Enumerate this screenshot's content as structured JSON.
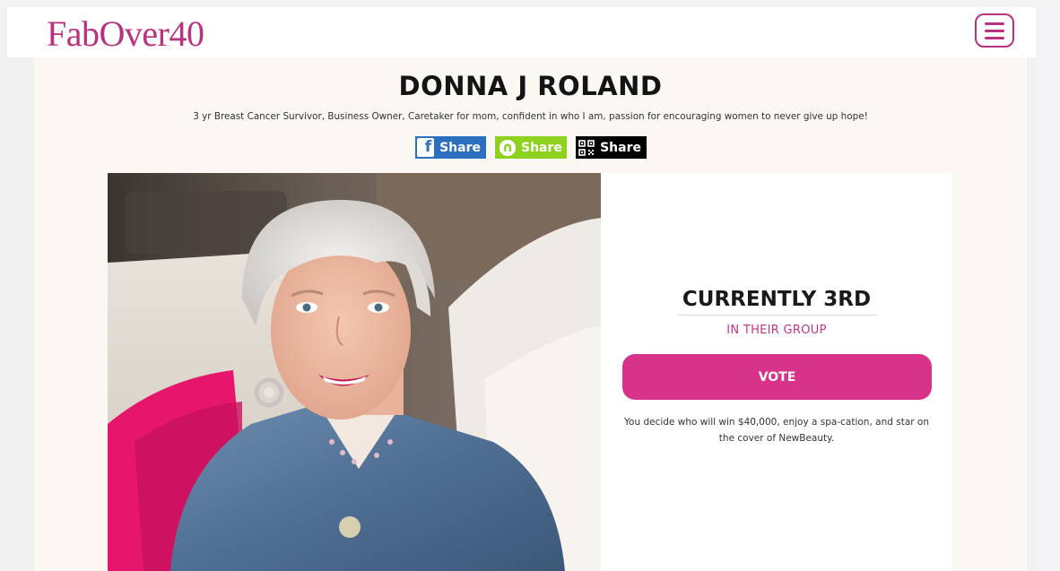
{
  "header": {
    "logo_text": "FabOver40",
    "menu_icon": "hamburger-menu-icon"
  },
  "profile": {
    "name": "DONNA J ROLAND",
    "bio": "3 yr Breast Cancer Survivor, Business Owner, Caretaker for mom, confident in who I am, passion for encouraging women to never give up hope!",
    "share_buttons": [
      {
        "label": "Share",
        "icon": "facebook-icon",
        "color": "#2d6fbf"
      },
      {
        "label": "Share",
        "icon": "nextdoor-icon",
        "color": "#8ed11e"
      },
      {
        "label": "Share",
        "icon": "qr-code-icon",
        "color": "#000000"
      }
    ]
  },
  "vote_card": {
    "rank_text": "CURRENTLY 3RD",
    "rank_sub": "IN THEIR GROUP",
    "vote_label": "VOTE",
    "note": "You decide who will win $40,000, enjoy a spa-cation, and star on the cover of NewBeauty."
  },
  "colors": {
    "brand": "#b8327f",
    "vote_button": "#d7338a",
    "page_bg": "#fbf7f2"
  }
}
